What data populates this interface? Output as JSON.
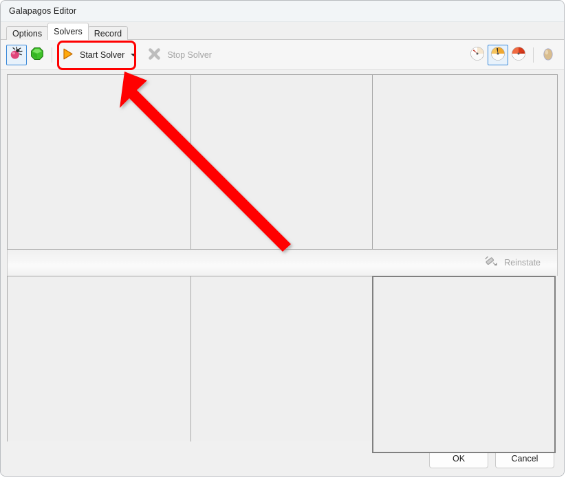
{
  "window": {
    "title": "Galapagos Editor"
  },
  "tabs": [
    {
      "label": "Options",
      "active": false
    },
    {
      "label": "Solvers",
      "active": true
    },
    {
      "label": "Record",
      "active": false
    }
  ],
  "toolbar": {
    "left_icons": [
      {
        "name": "beetle-icon",
        "selected": true
      },
      {
        "name": "gem-icon",
        "selected": false
      }
    ],
    "start_solver": {
      "label": "Start Solver",
      "icon": "play-icon",
      "has_dropdown": true,
      "enabled": true,
      "highlighted": true
    },
    "stop_solver": {
      "label": "Stop Solver",
      "icon": "cross-icon",
      "enabled": false
    },
    "right_icons": [
      {
        "name": "gauge-slow-icon",
        "selected": false
      },
      {
        "name": "gauge-medium-icon",
        "selected": true
      },
      {
        "name": "gauge-fast-icon",
        "selected": false
      },
      {
        "name": "egg-icon",
        "selected": false
      }
    ]
  },
  "middle_bar": {
    "reinstate": {
      "label": "Reinstate",
      "icon": "syringe-icon",
      "enabled": false
    }
  },
  "panels": {
    "top": [
      {
        "name": "genome-panel",
        "focused": false
      },
      {
        "name": "fitness-panel",
        "focused": false
      },
      {
        "name": "population-panel",
        "focused": false
      }
    ],
    "bottom": [
      {
        "name": "history-panel",
        "focused": false
      },
      {
        "name": "detail-panel",
        "focused": false
      },
      {
        "name": "preview-panel",
        "focused": true
      }
    ]
  },
  "footer": {
    "ok_label": "OK",
    "cancel_label": "Cancel"
  },
  "annotation": {
    "type": "arrow",
    "color": "#ff0000",
    "target": "start-solver-button"
  },
  "colors": {
    "highlight_red": "#ff0000",
    "selection_blue": "#3c8ad9",
    "play_orange": "#ffa000",
    "panel_bg": "#efefef"
  }
}
